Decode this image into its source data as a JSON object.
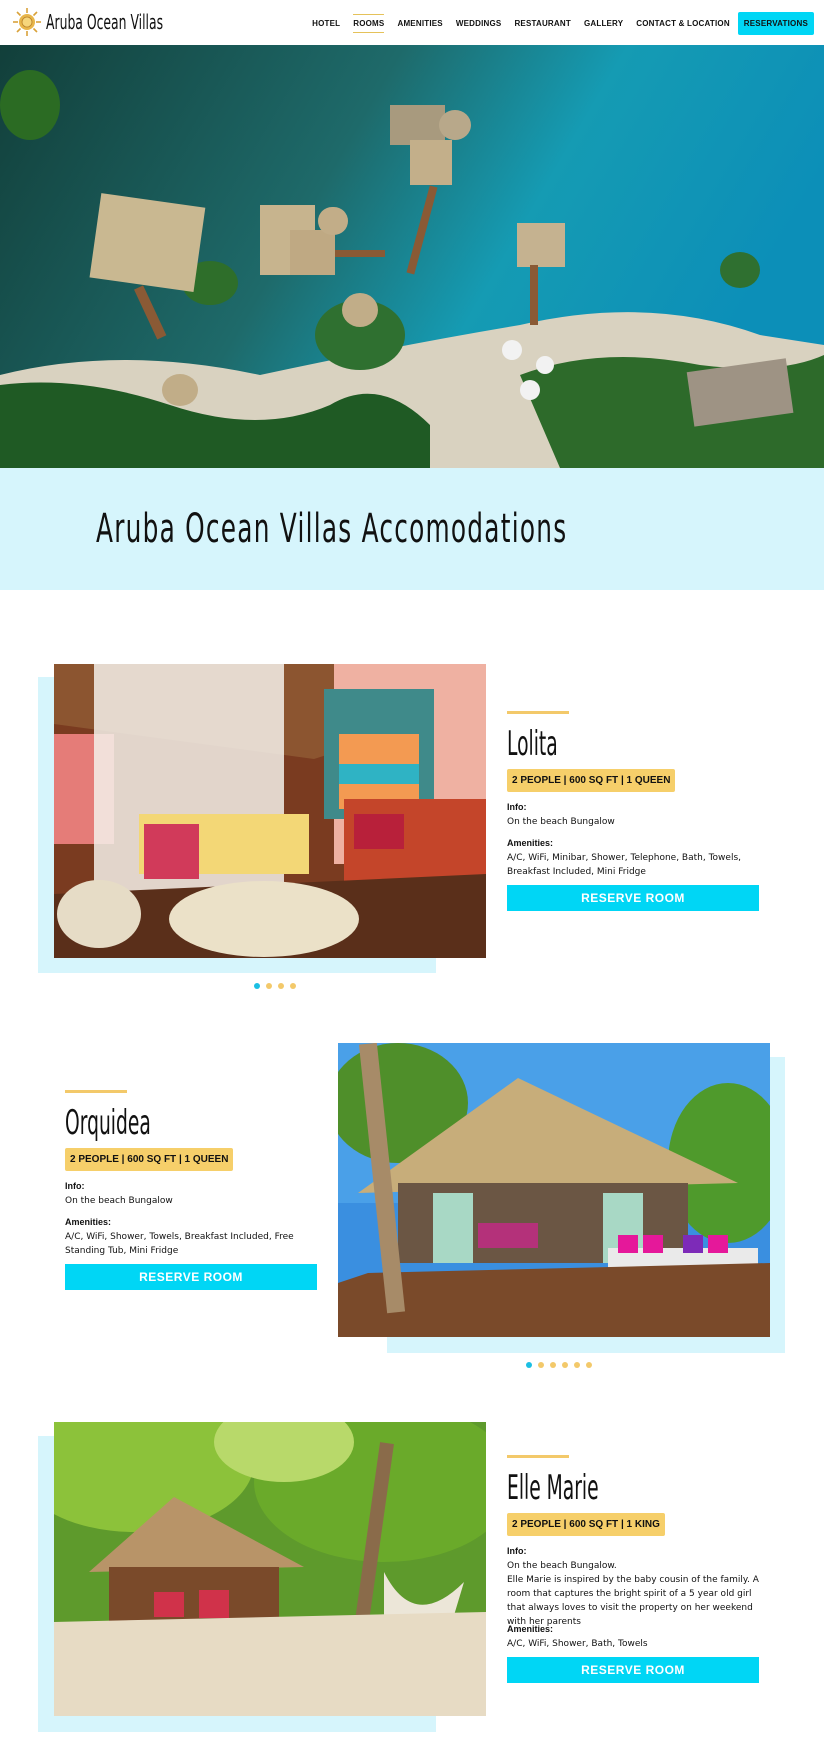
{
  "header": {
    "brand": "Aruba Ocean Villas",
    "nav": [
      "HOTEL",
      "ROOMS",
      "AMENITIES",
      "WEDDINGS",
      "RESTAURANT",
      "GALLERY",
      "CONTACT & LOCATION"
    ],
    "reservations": "RESERVATIONS"
  },
  "page": {
    "title": "Aruba Ocean Villas Accomodations"
  },
  "rooms": [
    {
      "name": "Lolita",
      "badge": "2 PEOPLE | 600 SQ FT | 1 QUEEN",
      "info_label": "Info:",
      "info": "On the beach Bungalow",
      "amenities_label": "Amenities:",
      "amenities": "A/C, WiFi, Minibar, Shower, Telephone, Bath, Towels, Breakfast Included, Mini Fridge",
      "button": "RESERVE ROOM",
      "dots": 4
    },
    {
      "name": "Orquidea",
      "badge": "2 PEOPLE | 600 SQ FT | 1 QUEEN",
      "info_label": "Info:",
      "info": "On the beach Bungalow",
      "amenities_label": "Amenities:",
      "amenities": "A/C, WiFi, Shower, Towels, Breakfast Included, Free Standing Tub, Mini Fridge",
      "button": "RESERVE ROOM",
      "dots": 6
    },
    {
      "name": "Elle Marie",
      "badge": "2 PEOPLE | 600 SQ FT | 1 KING",
      "info_label": "Info:",
      "info": "On the beach Bungalow.",
      "description": "Elle Marie is inspired by the baby cousin of the family. A room that captures the bright spirit of a 5 year old girl that always loves to visit the property on her weekend with her parents",
      "amenities_label": "Amenities:",
      "amenities": "A/C, WiFi, Shower, Bath, Towels",
      "button": "RESERVE ROOM"
    }
  ],
  "colors": {
    "accent": "#00d6f5",
    "gold": "#f3c96a",
    "pale": "#d6f5fc"
  }
}
